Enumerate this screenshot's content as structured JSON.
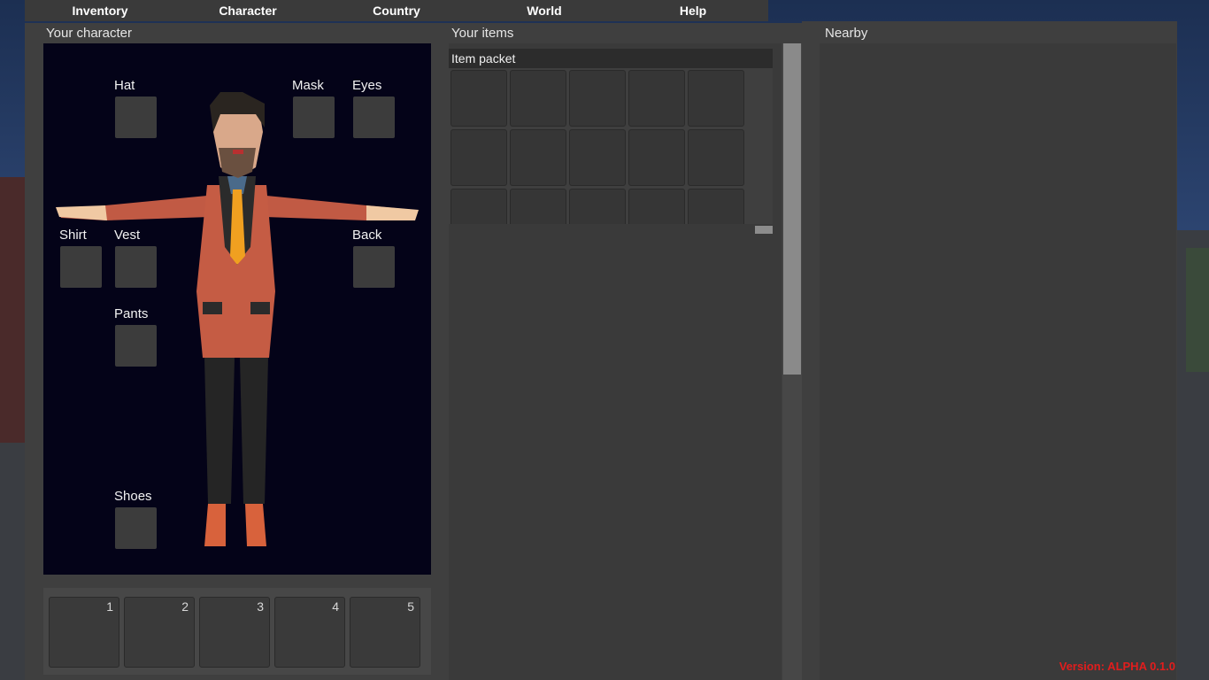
{
  "menu": {
    "tabs": [
      "Inventory",
      "Character",
      "Country",
      "World",
      "Help"
    ]
  },
  "character_panel": {
    "title": "Your character",
    "slots": {
      "hat": "Hat",
      "mask": "Mask",
      "eyes": "Eyes",
      "shirt": "Shirt",
      "vest": "Vest",
      "back": "Back",
      "pants": "Pants",
      "shoes": "Shoes"
    },
    "hotbar": [
      "1",
      "2",
      "3",
      "4",
      "5"
    ]
  },
  "items_panel": {
    "title": "Your items",
    "packet_title": "Item packet"
  },
  "nearby_panel": {
    "title": "Nearby"
  },
  "version": "Version: ALPHA 0.1.0",
  "colors": {
    "panel": "#3f3f3f",
    "slot": "#3c3c3c",
    "character_viewport": "#040318",
    "version_text": "#e21d1d"
  }
}
